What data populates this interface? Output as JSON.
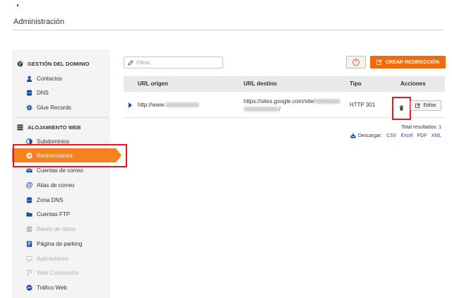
{
  "page": {
    "title": "Administración"
  },
  "sidebar": {
    "sections": [
      {
        "title": "GESTIÓN DEL DOMINIO",
        "icon": "globe-icon",
        "items": [
          {
            "label": "Contactos",
            "icon": "user-icon"
          },
          {
            "label": "DNS",
            "icon": "database-icon"
          },
          {
            "label": "Glue Records",
            "icon": "gear-icon"
          }
        ]
      },
      {
        "title": "ALOJAMIENTO WEB",
        "icon": "stack-icon",
        "items": [
          {
            "label": "Subdominios",
            "icon": "half-circle-icon"
          },
          {
            "label": "Redirecciones",
            "icon": "arrow-circle-icon",
            "active": true
          },
          {
            "label": "Cuentas de correo",
            "icon": "envelope-icon"
          },
          {
            "label": "Alias de correo",
            "icon": "at-icon"
          },
          {
            "label": "Zona DNS",
            "icon": "database-icon"
          },
          {
            "label": "Cuentas FTP",
            "icon": "folder-icon"
          },
          {
            "label": "Bases de datos",
            "icon": "database-icon",
            "disabled": true
          },
          {
            "label": "Página de parking",
            "icon": "page-icon"
          },
          {
            "label": "Aplicaciones",
            "icon": "monitor-icon",
            "disabled": true
          },
          {
            "label": "Web Constructor",
            "icon": "crane-icon",
            "disabled": true
          },
          {
            "label": "Tráfico Web",
            "icon": "chart-icon"
          }
        ]
      }
    ]
  },
  "toolbar": {
    "filter_placeholder": "Filtrar...",
    "help_label": "?",
    "create_label": "CREAR REDIRECCIÓN"
  },
  "table": {
    "headers": [
      "URL origen",
      "URL destino",
      "Tipo",
      "Acciones"
    ],
    "rows": [
      {
        "origin": "http://www.",
        "destination_line1": "https://sites.google.com/site/",
        "destination_line2": "/",
        "type": "HTTP 301",
        "edit_label": "Editar"
      }
    ]
  },
  "footer": {
    "total": "Total resultados: 1",
    "download_label": "Descargar:",
    "formats": [
      "CSV",
      "Excel",
      "PDF",
      "XML"
    ]
  },
  "colors": {
    "accent": "#f26a10",
    "highlight": "#e21b23",
    "link": "#1e4b9a"
  }
}
